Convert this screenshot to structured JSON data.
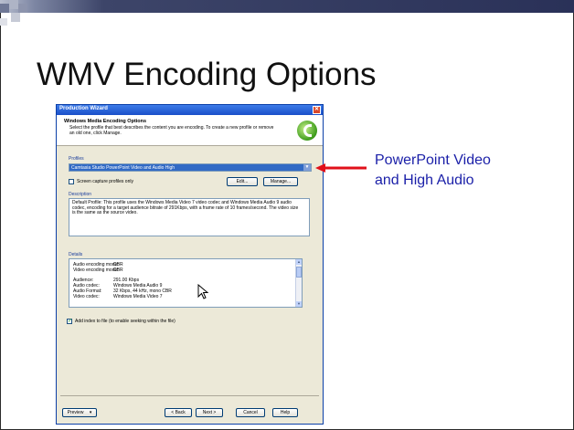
{
  "slide": {
    "title": "WMV Encoding Options",
    "annotation_line1": "PowerPoint Video",
    "annotation_line2": "and High Audio",
    "accent_color": "#2a3158",
    "annotation_color": "#1a1fa8",
    "arrow_color": "#e0101a"
  },
  "dialog": {
    "window_title": "Production Wizard",
    "header_title": "Windows Media Encoding Options",
    "header_desc": "Select the profile that best describes the content you are encoding. To create a new profile or remove an old one, click Manage.",
    "profiles_label": "Profiles",
    "selected_profile": "Camtasia Studio PowerPoint Video and Audio High",
    "screen_capture_only": "Screen capture profiles only",
    "edit_button": "Edit...",
    "manage_button": "Manage...",
    "description_label": "Description",
    "description_text": "Default Profile: This profile uses the Windows Media Video 7 video codec and Windows Media Audio 9 audio codec, encoding for a target audience bitrate of 291Kbps, with a frame rate of 10 frames/second. The video size is the same as the source video.",
    "details_label": "Details",
    "details": [
      {
        "label": "Audio encoding mode:",
        "value": "CBR"
      },
      {
        "label": "Video encoding mode:",
        "value": "CBR"
      },
      {
        "label": "Audience:",
        "value": "291.00 Kbps"
      },
      {
        "label": "Audio codec:",
        "value": "Windows Media Audio 9"
      },
      {
        "label": "Audio Format:",
        "value": "32 Kbps, 44 kHz, mono CBR"
      },
      {
        "label": "Video codec:",
        "value": "Windows Media Video 7"
      }
    ],
    "add_index_label": "Add index to file (to enable seeking within the file)",
    "preview_button": "Preview",
    "back_button": "< Back",
    "next_button": "Next >",
    "cancel_button": "Cancel",
    "help_button": "Help"
  }
}
